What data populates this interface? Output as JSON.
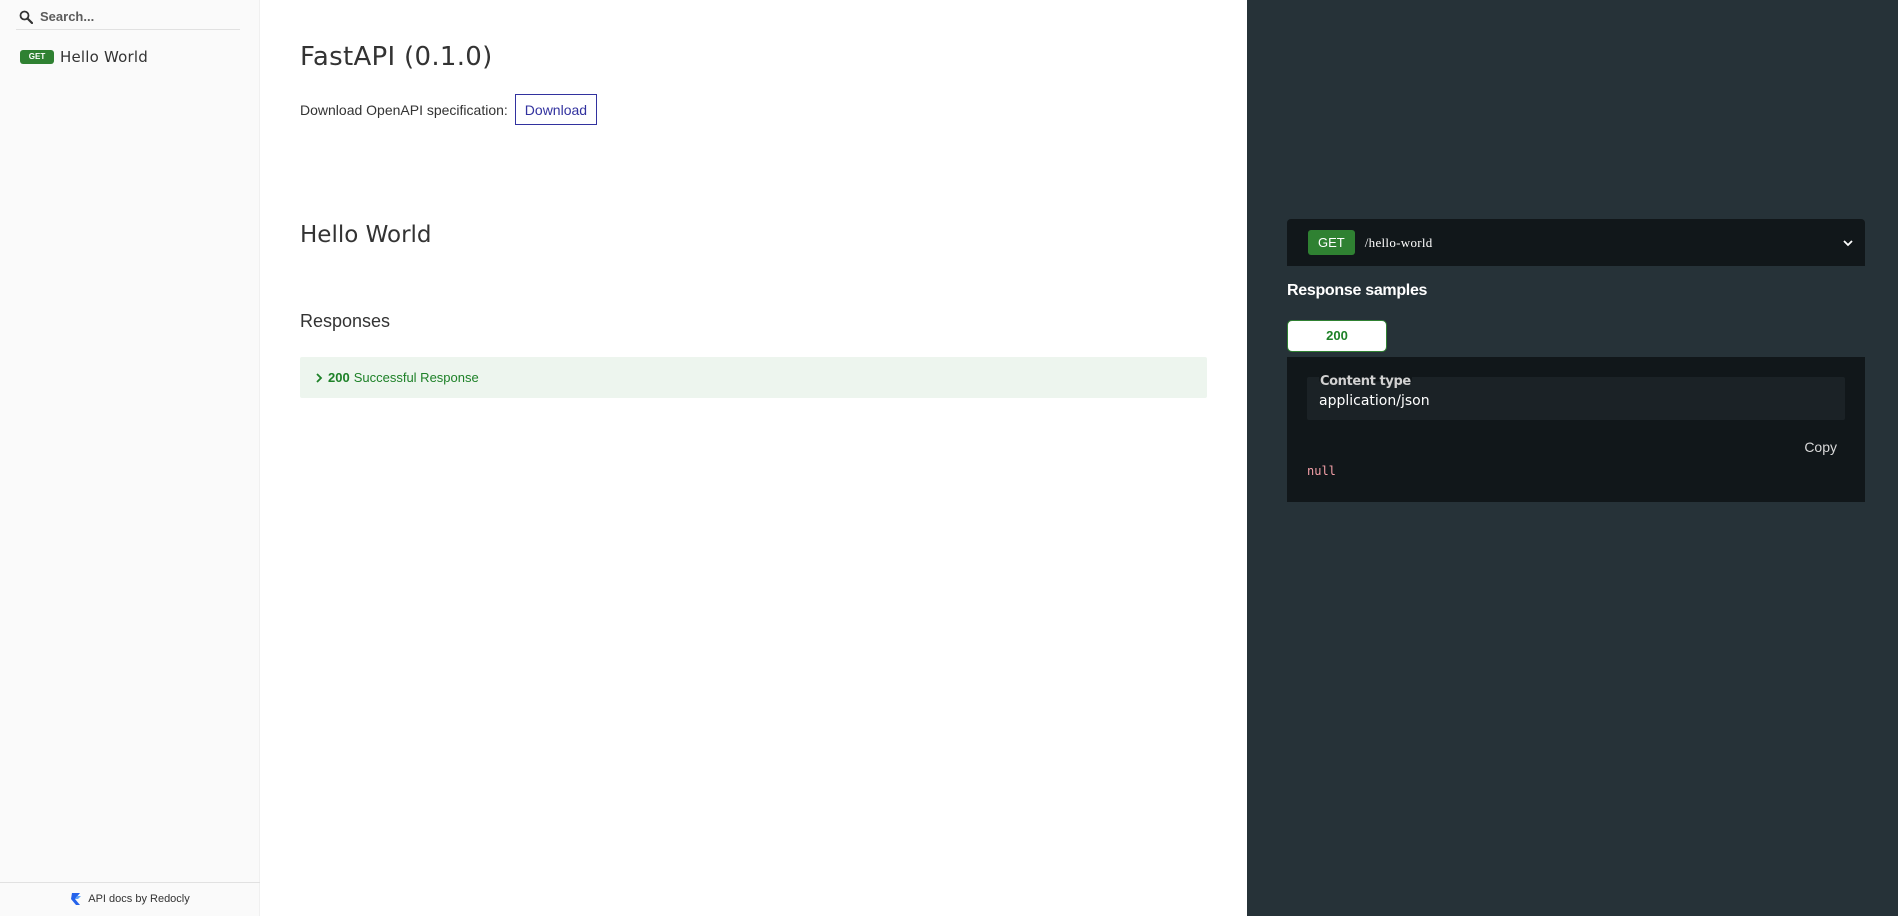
{
  "sidebar": {
    "search": {
      "placeholder": "Search...",
      "value": ""
    },
    "items": [
      {
        "method": "GET",
        "label": "Hello World"
      }
    ],
    "footer": {
      "text": "API docs by Redocly"
    }
  },
  "main": {
    "title": "FastAPI (0.1.0)",
    "download": {
      "label": "Download OpenAPI specification:",
      "button": "Download"
    },
    "operation": {
      "title": "Hello World",
      "responses_title": "Responses",
      "responses": [
        {
          "code": "200",
          "description": "Successful Response"
        }
      ]
    }
  },
  "right_panel": {
    "endpoint": {
      "method": "GET",
      "path": "/hello-world"
    },
    "samples_title": "Response samples",
    "tabs": [
      {
        "label": "200"
      }
    ],
    "content_type": {
      "label": "Content type",
      "value": "application/json"
    },
    "copy_label": "Copy",
    "sample_body": "null"
  },
  "colors": {
    "get_green": "#2f8132",
    "success_text": "#1d8127",
    "success_bg": "#edf5ee",
    "link_blue": "#32329f",
    "right_panel_bg": "#263238",
    "code_block_bg": "#11171a"
  },
  "icons": {
    "search": "search-icon",
    "chevron_right": "chevron-right-icon",
    "chevron_down": "chevron-down-icon",
    "redocly_logo": "redocly-logo-icon"
  }
}
